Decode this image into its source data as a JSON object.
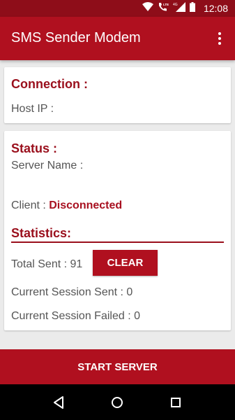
{
  "status_bar": {
    "time": "12:08",
    "network_label": "4G",
    "icons": [
      "wifi-icon",
      "call-lte-icon",
      "signal-icon",
      "battery-icon"
    ]
  },
  "app_bar": {
    "title": "SMS Sender Modem",
    "menu_icon": "more-vert-icon"
  },
  "connection": {
    "heading": "Connection :",
    "host_ip_label": "Host IP :"
  },
  "status": {
    "heading": "Status :",
    "server_name_label": "Server Name :",
    "client_label": "Client :",
    "client_value": "Disconnected"
  },
  "statistics": {
    "heading": "Statistics:",
    "total_sent": "Total Sent : 91",
    "clear_label": "CLEAR",
    "session_sent": "Current Session Sent : 0",
    "session_failed": "Current Session Failed : 0"
  },
  "actions": {
    "start_server_label": "START SERVER"
  },
  "nav_bar": {
    "icons": [
      "back-icon",
      "home-icon",
      "recents-icon"
    ]
  },
  "colors": {
    "primary": "#b0101f",
    "primary_dark": "#8e0d19",
    "heading": "#9a0f1c",
    "background": "#ebebeb"
  }
}
